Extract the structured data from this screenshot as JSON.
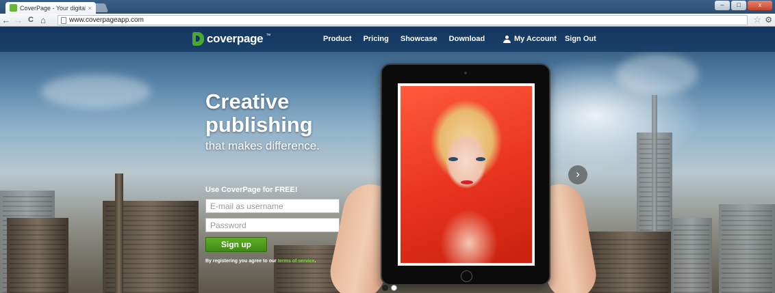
{
  "browser": {
    "tab_title": "CoverPage - Your digital p",
    "tab_close": "×",
    "url": "www.coverpageapp.com",
    "nav": {
      "back": "←",
      "forward": "→",
      "reload": "C",
      "home": "⌂"
    },
    "star": "☆",
    "wrench": "🔧",
    "window_controls": {
      "minimize": "–",
      "maximize": "□",
      "close": "x"
    }
  },
  "site": {
    "brand": "coverpage",
    "brand_mark": "™",
    "brand_color": "#4ba82e",
    "nav": [
      "Product",
      "Pricing",
      "Showcase",
      "Download"
    ],
    "my_account": "My Account",
    "sign_out": "Sign Out"
  },
  "hero": {
    "title_line1": "Creative",
    "title_line2": "publishing",
    "subtitle": "that makes difference.",
    "form_label": "Use CoverPage for FREE!",
    "email_placeholder": "E-mail as username",
    "password_placeholder": "Password",
    "signup_label": "Sign up",
    "terms_prefix": "By registering you agree to our ",
    "terms_link": "terms of service",
    "terms_suffix": "."
  },
  "carousel": {
    "next_label": "›",
    "slide_count": 2,
    "active_slide": 1
  }
}
